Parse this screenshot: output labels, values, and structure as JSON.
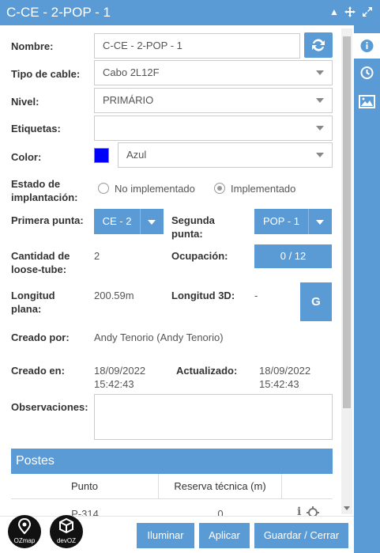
{
  "window": {
    "title": "C-CE - 2-POP - 1"
  },
  "sidebar": {
    "tabs": [
      "info-icon",
      "history-icon",
      "image-icon"
    ]
  },
  "form": {
    "nombre_label": "Nombre:",
    "nombre_value": "C-CE - 2-POP - 1",
    "tipo_label": "Tipo de cable:",
    "tipo_value": "Cabo 2L12F",
    "nivel_label": "Nivel:",
    "nivel_value": "PRIMÁRIO",
    "etiquetas_label": "Etiquetas:",
    "etiquetas_value": "",
    "color_label": "Color:",
    "color_value": "Azul",
    "color_swatch": "#0000ff",
    "estado_label_1": "Estado de",
    "estado_label_2": "implantación:",
    "estado_options": [
      "No implementado",
      "Implementado"
    ],
    "estado_selected": "Implementado",
    "primera_label": "Primera punta:",
    "primera_value": "CE - 2",
    "segunda_label_1": "Segunda",
    "segunda_label_2": "punta:",
    "segunda_value": "POP - 1",
    "cantidad_label_1": "Cantidad de",
    "cantidad_label_2": "loose-tube:",
    "cantidad_value": "2",
    "ocupacion_label": "Ocupación:",
    "ocupacion_value": "0 / 12",
    "longitud_label_1": "Longitud",
    "longitud_label_2": "plana:",
    "longitud_value": "200.59m",
    "longitud3d_label": "Longitud 3D:",
    "longitud3d_value": "-",
    "g_button": "G",
    "creado_por_label": "Creado por:",
    "creado_por_value": "Andy Tenorio (Andy Tenorio)",
    "creado_en_label": "Creado en:",
    "creado_en_date": "18/09/2022",
    "creado_en_time": "15:42:43",
    "actualizado_label": "Actualizado:",
    "actualizado_date": "18/09/2022",
    "actualizado_time": "15:42:43",
    "observaciones_label": "Observaciones:",
    "observaciones_value": ""
  },
  "postes": {
    "title": "Postes",
    "columns": [
      "Punto",
      "Reserva técnica (m)",
      ""
    ],
    "rows": [
      {
        "punto": "P-314",
        "reserva": "0"
      }
    ]
  },
  "footer": {
    "logo1": "OZmap",
    "logo2": "devOZ",
    "iluminar": "Iluminar",
    "aplicar": "Aplicar",
    "guardar": "Guardar / Cerrar"
  },
  "colors": {
    "accent": "#5b9bd5",
    "swatch": "#0000ff"
  }
}
